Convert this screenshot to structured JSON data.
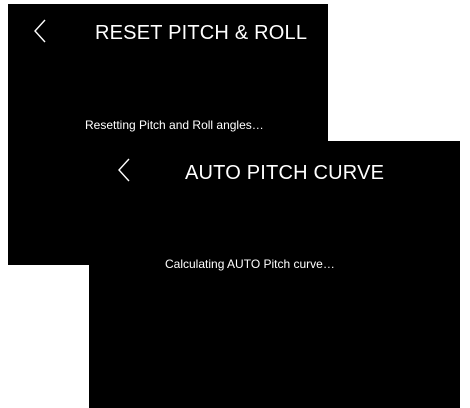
{
  "screens": [
    {
      "title": "RESET PITCH & ROLL",
      "message": "Resetting Pitch and Roll angles…",
      "back_icon": "chevron-left-icon"
    },
    {
      "title": "AUTO PITCH CURVE",
      "message": "Calculating AUTO Pitch curve…",
      "back_icon": "chevron-left-icon"
    }
  ],
  "colors": {
    "screen_background": "#000000",
    "text": "#ffffff",
    "page_background": "#ffffff"
  }
}
